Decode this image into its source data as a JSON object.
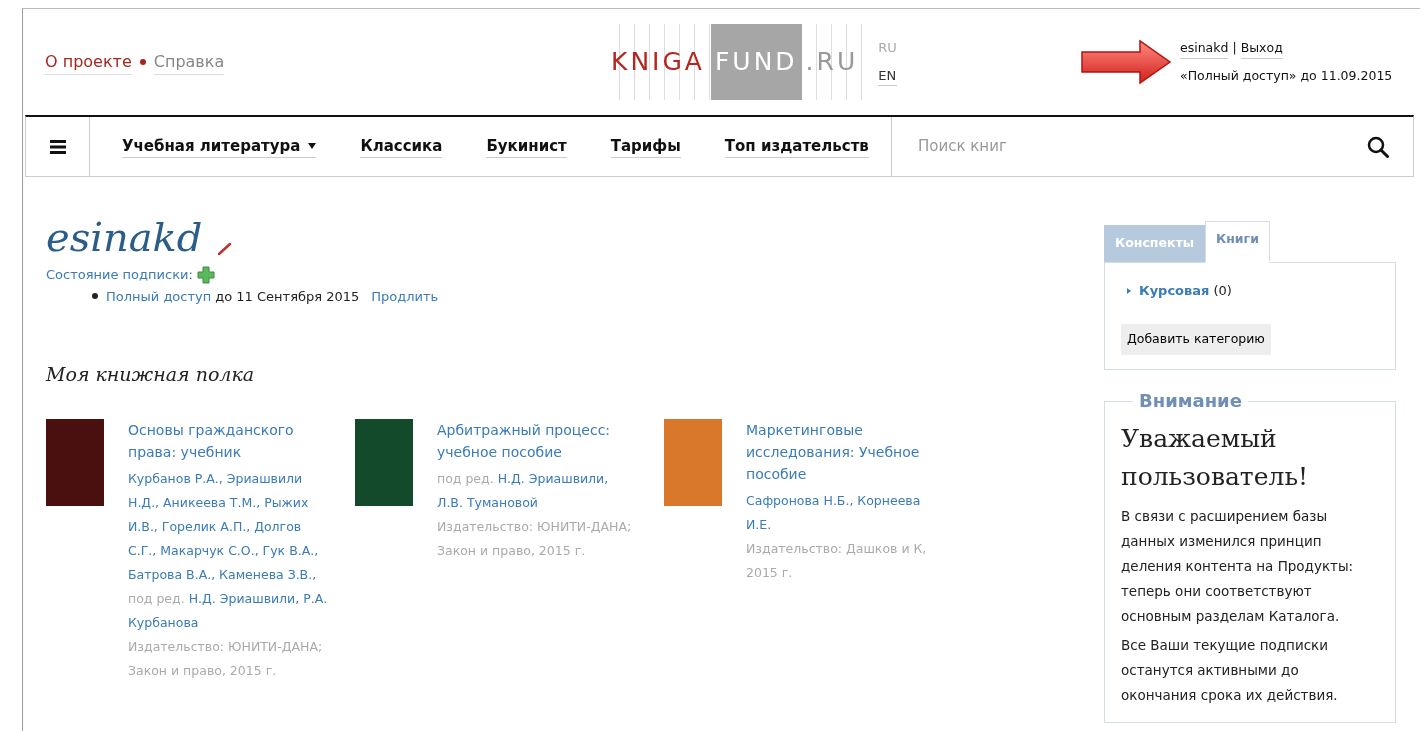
{
  "header": {
    "links": [
      {
        "label": "О проекте",
        "active": true
      },
      {
        "label": "Справка",
        "active": false
      }
    ],
    "logo": {
      "part_1": "KNIGA",
      "part_2": "FUND",
      "part_3": ".RU"
    },
    "languages": [
      {
        "label": "RU",
        "selected": false
      },
      {
        "label": "EN",
        "selected": true
      }
    ],
    "user": {
      "login": "esinakd",
      "separator": "|",
      "logout": "Выход",
      "subscription": "«Полный доступ» до 11.09.2015"
    }
  },
  "nav": {
    "items": [
      {
        "label": "Учебная литература",
        "dropdown": true
      },
      {
        "label": "Классика",
        "dropdown": false
      },
      {
        "label": "Букинист",
        "dropdown": false
      },
      {
        "label": "Тарифы",
        "dropdown": false
      },
      {
        "label": "Топ издательств",
        "dropdown": false
      }
    ],
    "search": {
      "placeholder": "Поиск книг"
    }
  },
  "profile": {
    "name": "esinakd",
    "subscription_label": "Состояние подписки:",
    "subscriptions": [
      {
        "plan": "Полный доступ",
        "until": "до 11 Сентября 2015",
        "action": "Продлить"
      }
    ]
  },
  "shelf": {
    "title": "Моя книжная полка",
    "books": [
      {
        "color": "#4a1010",
        "title": "Основы гражданского права: учебник",
        "credits": [
          {
            "names": "Курбанов Р.А., Эриашвили Н.Д., Аникеева Т.М., Рыжих И.В., Горелик А.П., Долгов С.Г., Макарчук С.О., Гук В.А., Батрова В.А., Каменева З.В.,"
          },
          {
            "prefix": "под ред.",
            "names": "Н.Д. Эриашвили, Р.А. Курбанова"
          }
        ],
        "publisher": "Издательство: ЮНИТИ-ДАНА; Закон и право, 2015 г."
      },
      {
        "color": "#134a2c",
        "title": "Арбитражный процесс: учебное пособие",
        "credits": [
          {
            "prefix": "под ред.",
            "names": "Н.Д. Эриашвили, Л.В. Тумановой"
          }
        ],
        "publisher": "Издательство: ЮНИТИ-ДАНА; Закон и право, 2015 г."
      },
      {
        "color": "#d9782a",
        "title": "Маркетинговые исследования: Учебное пособие",
        "credits": [
          {
            "names": "Сафронова Н.Б., Корнеева И.Е."
          }
        ],
        "publisher": "Издательство: Дашков и К, 2015 г."
      }
    ]
  },
  "sidebar": {
    "tabs": [
      {
        "label": "Конспекты",
        "selected": false
      },
      {
        "label": "Книги",
        "selected": true
      }
    ],
    "categories": [
      {
        "name": "Курсовая",
        "count": "(0)"
      }
    ],
    "add_button": "Добавить категорию",
    "notice": {
      "legend": "Внимание",
      "heading": "Уважаемый пользователь!",
      "paragraphs": [
        "В связи с расширением базы данных изменился принцип деления контента на Продукты: теперь они соответствуют основным разделам Каталога.",
        "Все Ваши текущие подписки останутся активными до окончания срока их действия."
      ]
    }
  }
}
